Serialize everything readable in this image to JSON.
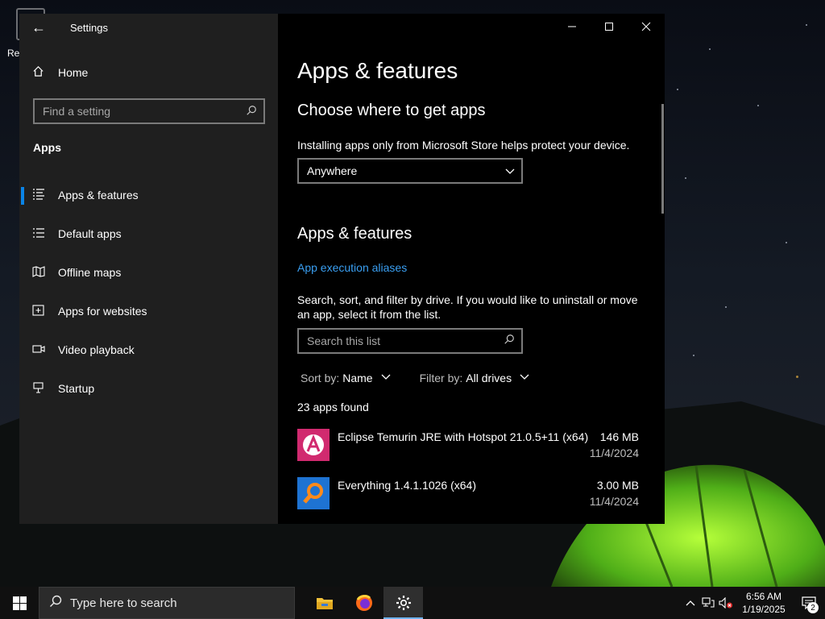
{
  "desktop": {
    "icon_label": "Rec"
  },
  "window": {
    "title": "Settings",
    "controls": {
      "minimize": "—",
      "maximize": "☐",
      "close": "✕"
    }
  },
  "sidebar": {
    "home_label": "Home",
    "search_placeholder": "Find a setting",
    "section_label": "Apps",
    "items": [
      {
        "label": "Apps & features",
        "icon": "apps-features-icon",
        "active": true
      },
      {
        "label": "Default apps",
        "icon": "default-apps-icon",
        "active": false
      },
      {
        "label": "Offline maps",
        "icon": "offline-maps-icon",
        "active": false
      },
      {
        "label": "Apps for websites",
        "icon": "apps-for-websites-icon",
        "active": false
      },
      {
        "label": "Video playback",
        "icon": "video-playback-icon",
        "active": false
      },
      {
        "label": "Startup",
        "icon": "startup-icon",
        "active": false
      }
    ]
  },
  "main": {
    "page_title": "Apps & features",
    "choose_heading": "Choose where to get apps",
    "choose_desc": "Installing apps only from Microsoft Store helps protect your device.",
    "source_selected": "Anywhere",
    "apps_heading": "Apps & features",
    "aliases_link": "App execution aliases",
    "list_desc": "Search, sort, and filter by drive. If you would like to uninstall or move an app, select it from the list.",
    "search_placeholder": "Search this list",
    "sort_label": "Sort by:",
    "sort_value": "Name",
    "filter_label": "Filter by:",
    "filter_value": "All drives",
    "count_text": "23 apps found",
    "apps": [
      {
        "name": "Eclipse Temurin JRE with Hotspot 21.0.5+11 (x64)",
        "size": "146 MB",
        "date": "11/4/2024",
        "icon": "eclipse-temurin-icon"
      },
      {
        "name": "Everything 1.4.1.1026 (x64)",
        "size": "3.00 MB",
        "date": "11/4/2024",
        "icon": "everything-search-icon"
      }
    ]
  },
  "taskbar": {
    "search_placeholder": "Type here to search",
    "time": "6:56 AM",
    "date": "1/19/2025",
    "notification_count": "2"
  },
  "colors": {
    "accent": "#0a84e6",
    "link": "#3a9ff2"
  }
}
